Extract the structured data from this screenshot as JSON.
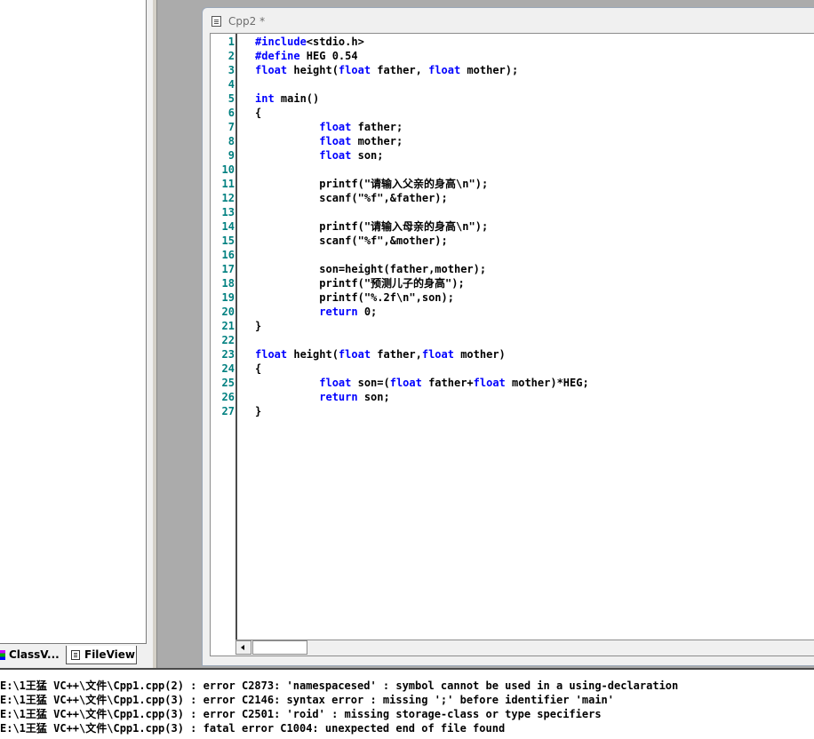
{
  "workspace": {
    "tabs": [
      {
        "label": "ClassV..."
      },
      {
        "label": "FileView"
      }
    ]
  },
  "editor": {
    "title": "Cpp2 *",
    "line_numbers": [
      "1",
      "2",
      "3",
      "4",
      "5",
      "6",
      "7",
      "8",
      "9",
      "10",
      "11",
      "12",
      "13",
      "14",
      "15",
      "16",
      "17",
      "18",
      "19",
      "20",
      "21",
      "22",
      "23",
      "24",
      "25",
      "26",
      "27"
    ],
    "lines": [
      {
        "kw": "#include",
        "text": "<stdio.h>"
      },
      {
        "kw": "#define",
        "text": " HEG 0.54"
      },
      {
        "kw": "float",
        "text": " height(",
        "kw2": "float",
        "text2": " father, ",
        "kw3": "float",
        "text3": " mother);"
      },
      {
        "text": ""
      },
      {
        "kw": "int",
        "text": " main()"
      },
      {
        "text": "{"
      },
      {
        "indent": "          ",
        "kw": "float",
        "text": " father;"
      },
      {
        "indent": "          ",
        "kw": "float",
        "text": " mother;"
      },
      {
        "indent": "          ",
        "kw": "float",
        "text": " son;"
      },
      {
        "text": ""
      },
      {
        "indent": "          ",
        "text": "printf(\"请输入父亲的身高\\n\");"
      },
      {
        "indent": "          ",
        "text": "scanf(\"%f\",&father);"
      },
      {
        "text": ""
      },
      {
        "indent": "          ",
        "text": "printf(\"请输入母亲的身高\\n\");"
      },
      {
        "indent": "          ",
        "text": "scanf(\"%f\",&mother);"
      },
      {
        "text": ""
      },
      {
        "indent": "          ",
        "text": "son=height(father,mother);"
      },
      {
        "indent": "          ",
        "text": "printf(\"预测儿子的身高\");"
      },
      {
        "indent": "          ",
        "text": "printf(\"%.2f\\n\",son);"
      },
      {
        "indent": "          ",
        "kw": "return",
        "text": " 0;"
      },
      {
        "text": "}"
      },
      {
        "text": ""
      },
      {
        "kw": "float",
        "text": " height(",
        "kw2": "float",
        "text2": " father,",
        "kw3": "float",
        "text3": " mother)"
      },
      {
        "text": "{"
      },
      {
        "indent": "          ",
        "kw": "float",
        "text": " son=(",
        "kw2": "float",
        "text2": " father+",
        "kw3": "float",
        "text3": " mother)*HEG;"
      },
      {
        "indent": "          ",
        "kw": "return",
        "text": " son;"
      },
      {
        "text": "}"
      }
    ]
  },
  "output": {
    "lines": [
      "E:\\1王猛 VC++\\文件\\Cpp1.cpp(2) : error C2873: 'namespacesed' : symbol cannot be used in a using-declaration",
      "E:\\1王猛 VC++\\文件\\Cpp1.cpp(3) : error C2146: syntax error : missing ';' before identifier 'main'",
      "E:\\1王猛 VC++\\文件\\Cpp1.cpp(3) : error C2501: 'roid' : missing storage-class or type specifiers",
      "E:\\1王猛 VC++\\文件\\Cpp1.cpp(3) : fatal error C1004: unexpected end of file found"
    ]
  },
  "colors": {
    "keyword": "#0000ff",
    "line_number": "#008080",
    "mdi_background": "#ababab"
  }
}
